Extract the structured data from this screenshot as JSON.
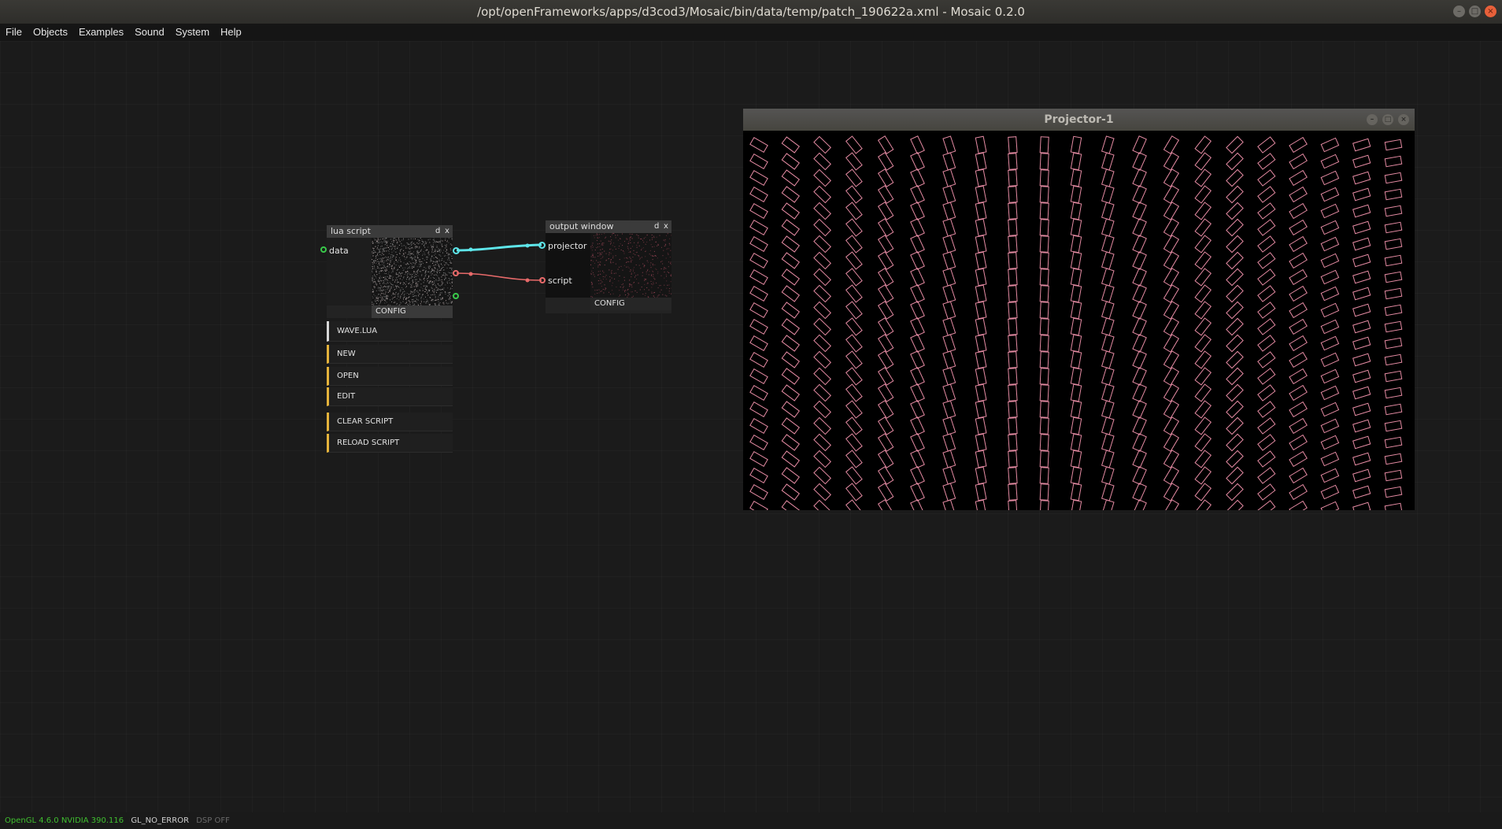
{
  "window": {
    "title": "/opt/openFrameworks/apps/d3cod3/Mosaic/bin/data/temp/patch_190622a.xml - Mosaic 0.2.0",
    "controls": [
      "minimize-icon",
      "maximize-icon",
      "close-icon"
    ]
  },
  "menu": [
    "File",
    "Objects",
    "Examples",
    "Sound",
    "System",
    "Help"
  ],
  "lua_node": {
    "title": "lua script",
    "btn_d": "d",
    "btn_x": "x",
    "inlet_label": "data",
    "config_label": "CONFIG",
    "inlet_color": "#39c94a",
    "outlet_colors": [
      "#5ee6ea",
      "#e86a6a",
      "#39c94a"
    ],
    "panel": {
      "filename": "WAVE.LUA",
      "buttons": [
        "NEW",
        "OPEN",
        "EDIT"
      ],
      "buttons2": [
        "CLEAR SCRIPT",
        "RELOAD SCRIPT"
      ],
      "accent": "#e5b33b"
    }
  },
  "output_node": {
    "title": "output window",
    "btn_d": "d",
    "btn_x": "x",
    "inlets": [
      "projector",
      "script"
    ],
    "config_label": "CONFIG"
  },
  "cables": {
    "projector_color": "#5ee6ea",
    "script_color": "#e86a6a"
  },
  "projector": {
    "title": "Projector-1",
    "controls": [
      "minimize-icon",
      "maximize-icon",
      "close-icon"
    ],
    "rect_color": "#e58ba3",
    "columns": 21,
    "rows": 23
  },
  "status": {
    "opengl": "OpenGL 4.6.0 NVIDIA 390.116",
    "gl_error": "GL_NO_ERROR",
    "dsp": "DSP OFF",
    "colors": {
      "opengl": "#3fbf2f",
      "gl_error": "#d0d0d0",
      "dsp": "#6a6a6a"
    }
  }
}
